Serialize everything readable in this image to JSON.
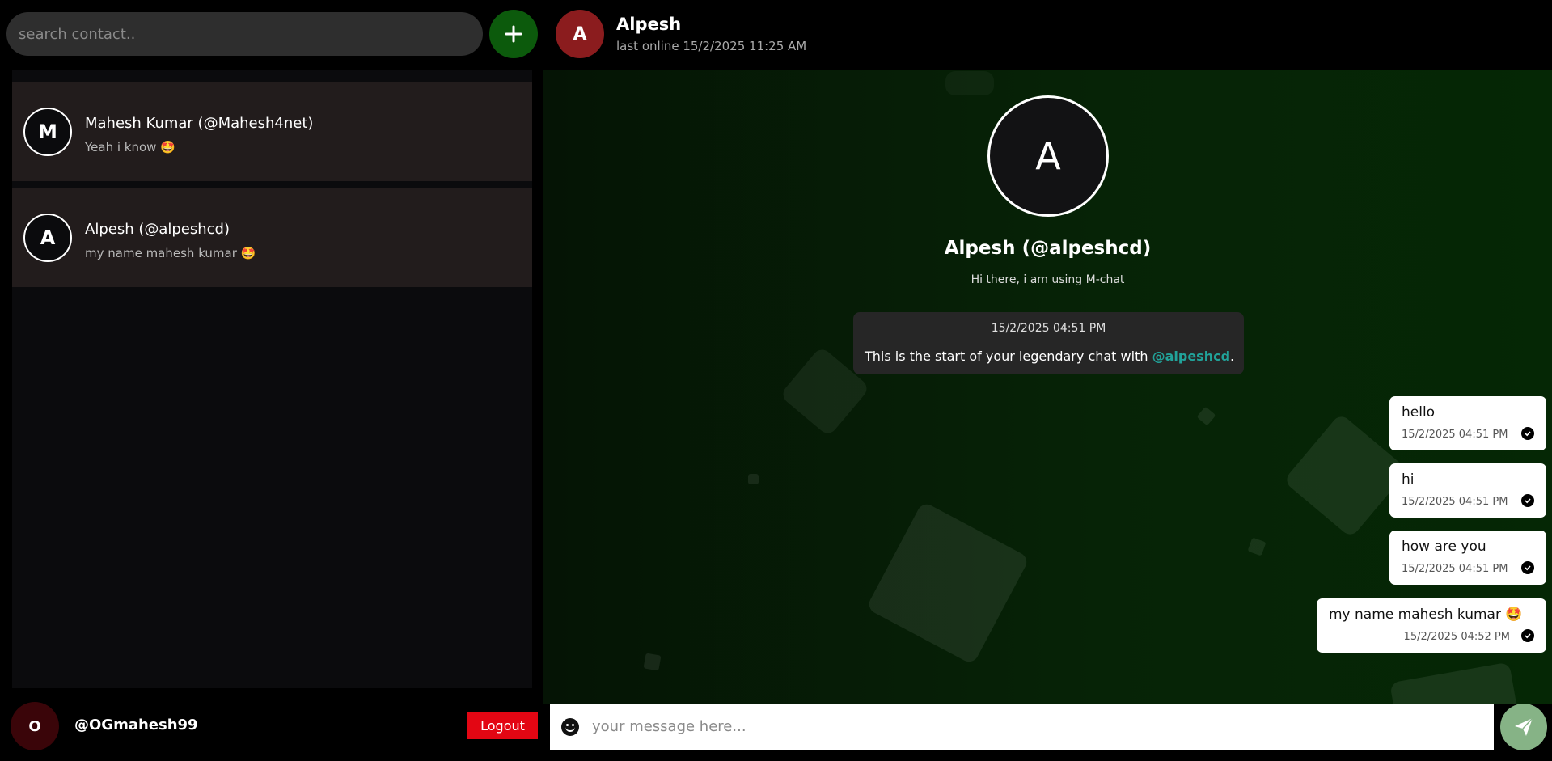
{
  "sidebar": {
    "search": {
      "placeholder": "search contact..",
      "value": ""
    },
    "add_contact_icon": "plus-icon",
    "contacts": [
      {
        "initial": "M",
        "name": "Mahesh Kumar (@Mahesh4net)",
        "preview": "Yeah i know 🤩"
      },
      {
        "initial": "A",
        "name": "Alpesh (@alpeshcd)",
        "preview": "my name mahesh kumar 🤩"
      }
    ],
    "me": {
      "initial": "O",
      "username": "@OGmahesh99"
    },
    "logout_label": "Logout"
  },
  "chat": {
    "header": {
      "initial": "A",
      "name": "Alpesh",
      "status": "last online 15/2/2025 11:25 AM"
    },
    "profile": {
      "initial": "A",
      "name": "Alpesh (@alpeshcd)",
      "bio": "Hi there, i am using M-chat"
    },
    "start_notice": {
      "date": "15/2/2025 04:51 PM",
      "text": "This is the start of your legendary chat with ",
      "mention": "@alpeshcd",
      "suffix": "."
    },
    "messages": [
      {
        "text": "hello",
        "time": "15/2/2025 04:51 PM",
        "status_icon": "check-icon"
      },
      {
        "text": "hi",
        "time": "15/2/2025 04:51 PM",
        "status_icon": "check-icon"
      },
      {
        "text": "how are you",
        "time": "15/2/2025 04:51 PM",
        "status_icon": "check-icon"
      },
      {
        "text": "my name mahesh kumar 🤩",
        "time": "15/2/2025 04:52 PM",
        "status_icon": "check-icon"
      }
    ],
    "input": {
      "placeholder": "your message here...",
      "value": ""
    },
    "send_icon": "send-icon",
    "emoji_icon": "emoji-icon"
  },
  "colors": {
    "add_button": "#0c5a0c",
    "logout": "#e30613",
    "header_avatar": "#8b1c1e",
    "mention": "#21a39a",
    "send_button": "#86b386"
  }
}
